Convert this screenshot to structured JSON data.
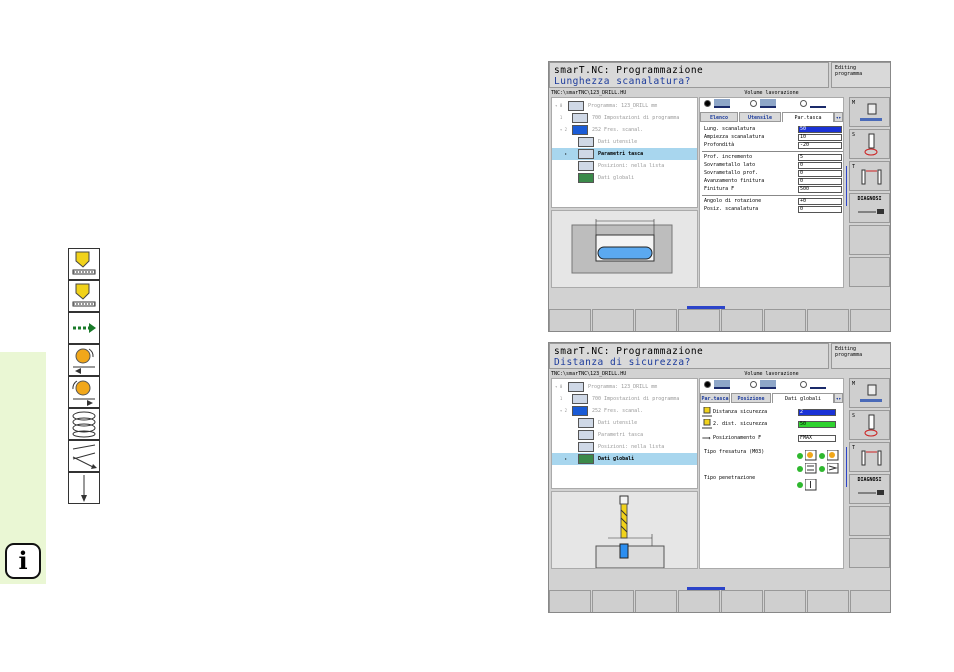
{
  "info_button": {
    "label": "i"
  },
  "left_icons": [
    {
      "name": "drill-tool-down-icon"
    },
    {
      "name": "drill-tool-icon"
    },
    {
      "name": "dashed-arrow-right-icon"
    },
    {
      "name": "milling-rotate-left-icon"
    },
    {
      "name": "milling-rotate-right-icon"
    },
    {
      "name": "helix-icon"
    },
    {
      "name": "ramp-arrows-icon"
    },
    {
      "name": "plunge-arrow-icon"
    }
  ],
  "screen1": {
    "title": "smarT.NC: Programmazione",
    "question": "Lunghezza scanalatura?",
    "mode": [
      "Editing",
      "programma"
    ],
    "path": "TNC:\\smarTNC\\123_DRILL.HU",
    "volume": "Volume lavorazione",
    "tree": [
      {
        "label": "Programma: 123_DRILL mm"
      },
      {
        "label": "700 Impostazioni di programma"
      },
      {
        "label": "252 Fres. scanal."
      },
      {
        "label": "Dati utensile"
      },
      {
        "label": "Parametri tasca"
      },
      {
        "label": "Posizioni: nella lista"
      },
      {
        "label": "Dati globali"
      }
    ],
    "tabs": [
      "Elenco",
      "Utensile",
      "Par.tasca",
      "◂▸"
    ],
    "fields_a": [
      {
        "label": "Lung. scanalatura",
        "value": "50"
      },
      {
        "label": "Ampiezza scanalatura",
        "value": "10"
      },
      {
        "label": "Profondità",
        "value": "-20"
      }
    ],
    "fields_b": [
      {
        "label": "Prof. incremento",
        "value": "5"
      },
      {
        "label": "Sovrametallo lato",
        "value": "0"
      },
      {
        "label": "Sovrametallo prof.",
        "value": "0"
      },
      {
        "label": "Avanzamento finitura",
        "value": "0"
      },
      {
        "label": "Finitura F",
        "value": "500"
      }
    ],
    "fields_c": [
      {
        "label": "Angolo di rotazione",
        "value": "+0"
      },
      {
        "label": "Posiz. scanalatura",
        "value": "0"
      }
    ],
    "side_buttons": [
      {
        "label": "M"
      },
      {
        "label": "S"
      },
      {
        "label": "T"
      },
      {
        "label": "DIAGNOSI"
      }
    ]
  },
  "screen2": {
    "title": "smarT.NC: Programmazione",
    "question": "Distanza di sicurezza?",
    "mode": [
      "Editing",
      "programma"
    ],
    "path": "TNC:\\smarTNC\\123_DRILL.HU",
    "volume": "Volume lavorazione",
    "tree": [
      {
        "label": "Programma: 123_DRILL mm"
      },
      {
        "label": "700 Impostazioni di programma"
      },
      {
        "label": "252 Fres. scanal."
      },
      {
        "label": "Dati utensile"
      },
      {
        "label": "Parametri tasca"
      },
      {
        "label": "Posizioni: nella lista"
      },
      {
        "label": "Dati globali"
      }
    ],
    "tabs": [
      "Par.tasca",
      "Posizione",
      "Dati globali",
      "◂▸"
    ],
    "fields": [
      {
        "label": "Distanza sicurezza",
        "value": "2"
      },
      {
        "label": "2. dist. sicurezza",
        "value": "50"
      },
      {
        "label": "Posizionamento F",
        "value": "FMAX"
      }
    ],
    "tipo_fresatura": "Tipo fresatura (M03)",
    "tipo_penetrazione": "Tipo penetrazione",
    "side_buttons": [
      {
        "label": "M"
      },
      {
        "label": "S"
      },
      {
        "label": "T"
      },
      {
        "label": "DIAGNOSI"
      }
    ]
  },
  "colors": {
    "accent_blue": "#1a32d6",
    "selection": "#a8d6ee",
    "green": "#2fd32f",
    "info_strip": "#eaf7d4"
  }
}
